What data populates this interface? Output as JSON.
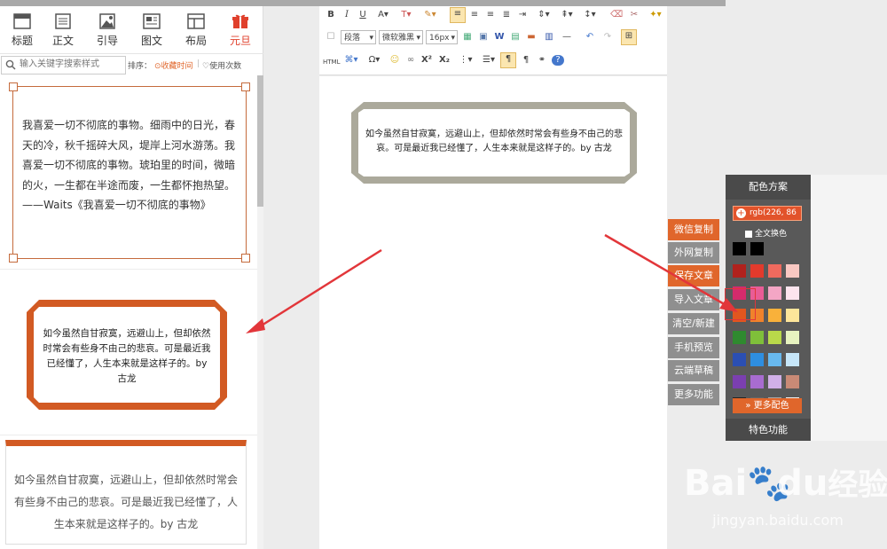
{
  "left_tabs": [
    {
      "label": "标题",
      "icon": "title-icon"
    },
    {
      "label": "正文",
      "icon": "text-icon"
    },
    {
      "label": "引导",
      "icon": "image-icon"
    },
    {
      "label": "图文",
      "icon": "image-text-icon"
    },
    {
      "label": "布局",
      "icon": "layout-icon"
    },
    {
      "label": "元旦",
      "icon": "gift-icon"
    }
  ],
  "search": {
    "placeholder": "输入关键字搜索样式",
    "sort_label": "排序：",
    "sort_fav": "收藏时间",
    "sort_use": "使用次数"
  },
  "cards": {
    "card1_text": "我喜爱一切不彻底的事物。细雨中的日光，春天的冷，秋千摇碎大风，堤岸上河水游荡。我喜爱一切不彻底的事物。琥珀里的时间，微暗的火，一生都在半途而废，一生都怀抱热望。——Waits《我喜爱一切不彻底的事物》",
    "card2_text": "如今虽然自甘寂寞，远避山上，但却依然时常会有些身不由己的悲哀。可是最近我已经懂了，人生本来就是这样子的。by 古龙",
    "card3_text": "如今虽然自甘寂寞，远避山上，但却依然时常会有些身不由己的悲哀。可是最近我已经懂了，人生本来就是这样子的。by 古龙"
  },
  "editor": {
    "paragraph_select": "段落",
    "font_select": "微软雅黑",
    "size_select": "16px",
    "canvas_text": "如今虽然自甘寂寞，远避山上，但却依然时常会有些身不由己的悲哀。可是最近我已经懂了，人生本来就是这样子的。by 古龙"
  },
  "side_buttons": [
    "微信复制",
    "外网复制",
    "保存文章",
    "导入文章",
    "清空/新建",
    "手机预览",
    "云端草稿",
    "更多功能"
  ],
  "color_panel": {
    "title": "配色方案",
    "rgb_value": "rgb(226, 86",
    "whole_text_label": "全文换色",
    "more_colors": "更多配色",
    "special": "特色功能",
    "swatches": [
      "#000000",
      "#000000",
      "#b0221d",
      "#e23a2c",
      "#f06a5e",
      "#f9c8c2",
      "#d42b6c",
      "#e95c96",
      "#f4a6c5",
      "#fde5ee",
      "#e2561f",
      "#f0822b",
      "#f9b13a",
      "#fde59a",
      "#2f8a2f",
      "#7fbf3a",
      "#b9d94a",
      "#e7f3c0",
      "#2b4fb3",
      "#2e8ee0",
      "#68b9ef",
      "#c6e6f9",
      "#7b3fb0",
      "#a86cd0",
      "#d1b0e8",
      "#c98a76",
      "#222222",
      "#666666",
      "#aaaaaa",
      "#f4f4f4"
    ]
  },
  "colors": {
    "accent": "#e0662b",
    "card_border": "#c56b3c",
    "hex_gray": "#aba99b",
    "hex_orange": "#d25a23",
    "arrow": "#e2363a"
  },
  "watermark": {
    "brand": "Bai",
    "brand2": "du",
    "brand3": "经验",
    "url": "jingyan.baidu.com"
  }
}
